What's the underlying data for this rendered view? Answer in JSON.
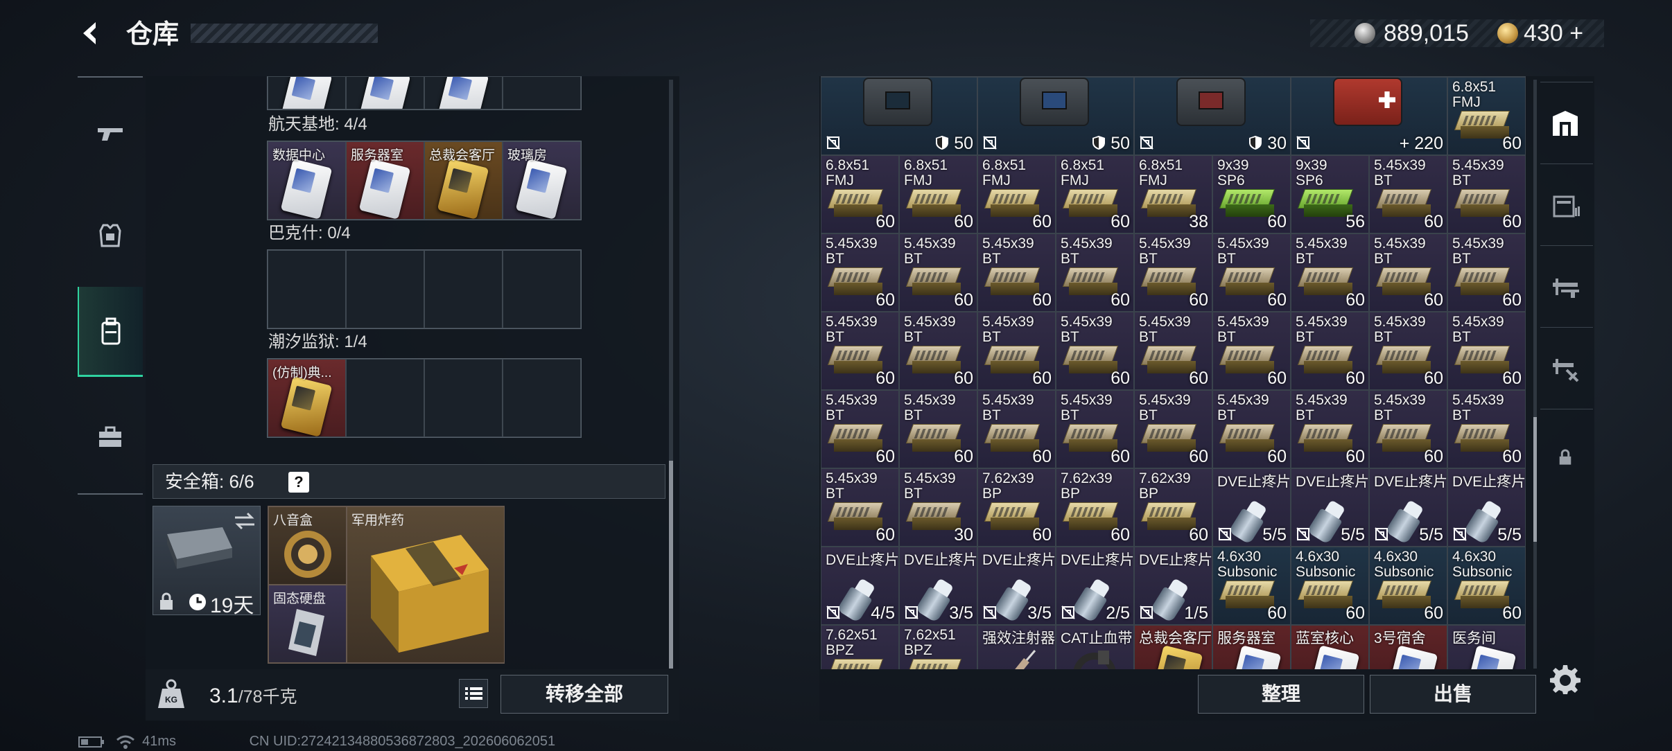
{
  "header": {
    "back_icon": "back-arrow-icon",
    "title": "仓库"
  },
  "currency": {
    "silver": "889,015",
    "gold": "430",
    "gold_add": "+"
  },
  "left_nav": [
    "weapons",
    "armor",
    "backpack",
    "toolbox"
  ],
  "keycards": {
    "top_row": [
      "",
      "",
      "",
      ""
    ],
    "sections": [
      {
        "label": "航天基地: 4/4",
        "items": [
          {
            "name": "数据中心",
            "color": "purple",
            "card": "white"
          },
          {
            "name": "服务器室",
            "color": "red",
            "card": "white"
          },
          {
            "name": "总裁会客厅",
            "color": "orange",
            "card": "gold"
          },
          {
            "name": "玻璃房",
            "color": "purple",
            "card": "white"
          }
        ]
      },
      {
        "label": "巴克什: 0/4",
        "items": [
          {
            "name": "",
            "color": "none",
            "card": ""
          },
          {
            "name": "",
            "color": "none",
            "card": ""
          },
          {
            "name": "",
            "color": "none",
            "card": ""
          },
          {
            "name": "",
            "color": "none",
            "card": ""
          }
        ]
      },
      {
        "label": "潮汐监狱: 1/4",
        "items": [
          {
            "name": "(仿制)典...",
            "color": "red",
            "card": "gold"
          },
          {
            "name": "",
            "color": "none",
            "card": ""
          },
          {
            "name": "",
            "color": "none",
            "card": ""
          },
          {
            "name": "",
            "color": "none",
            "card": ""
          }
        ]
      }
    ]
  },
  "safe_box": {
    "label": "安全箱:  6/6",
    "help": "?",
    "days": "19天",
    "items": [
      {
        "name": "八音盒"
      },
      {
        "name": "军用炸药"
      },
      {
        "name": "固态硬盘"
      }
    ]
  },
  "weight": {
    "value": "3.1",
    "max": "/78千克",
    "transfer_all": "转移全部"
  },
  "status": {
    "ping": "41ms",
    "uid": "CN UID:27242134880536872803_202606062051"
  },
  "stash": {
    "rows": [
      [
        {
          "type": "bag",
          "variant": "gray",
          "l1": "",
          "l2": "",
          "count": "50",
          "nosell": true,
          "shield": true,
          "color": "teal"
        },
        {
          "type": "bag2",
          "variant": "blue",
          "l1": "",
          "l2": "",
          "count": "50",
          "nosell": true,
          "shield": true,
          "color": "teal"
        },
        {
          "type": "bag2",
          "variant": "red",
          "l1": "",
          "l2": "",
          "count": "30",
          "nosell": true,
          "shield": true,
          "color": "teal"
        },
        {
          "type": "bag2",
          "variant": "med",
          "l1": "",
          "l2": "",
          "count": "+ 220",
          "nosell": true,
          "color": "teal"
        },
        {
          "type": "ammo",
          "variant": "",
          "l1": "6.8x51",
          "l2": "FMJ",
          "count": "60",
          "color": "teal"
        }
      ],
      [
        {
          "type": "ammo",
          "variant": "",
          "l1": "6.8x51",
          "l2": "FMJ",
          "count": "60",
          "color": "purple"
        },
        {
          "type": "ammo",
          "variant": "",
          "l1": "6.8x51",
          "l2": "FMJ",
          "count": "60",
          "color": "purple"
        },
        {
          "type": "ammo",
          "variant": "",
          "l1": "6.8x51",
          "l2": "FMJ",
          "count": "60",
          "color": "purple"
        },
        {
          "type": "ammo",
          "variant": "",
          "l1": "6.8x51",
          "l2": "FMJ",
          "count": "60",
          "color": "purple"
        },
        {
          "type": "ammo",
          "variant": "",
          "l1": "6.8x51",
          "l2": "FMJ",
          "count": "38",
          "color": "purple"
        },
        {
          "type": "ammo",
          "variant": "green",
          "l1": "9x39",
          "l2": "SP6",
          "count": "60",
          "color": "purple"
        },
        {
          "type": "ammo",
          "variant": "green",
          "l1": "9x39",
          "l2": "SP6",
          "count": "56",
          "color": "purple"
        },
        {
          "type": "ammo",
          "variant": "dark",
          "l1": "5.45x39",
          "l2": "BT",
          "count": "60",
          "color": "purple"
        },
        {
          "type": "ammo",
          "variant": "dark",
          "l1": "5.45x39",
          "l2": "BT",
          "count": "60",
          "color": "purple"
        }
      ],
      [
        {
          "type": "ammo",
          "variant": "dark",
          "l1": "5.45x39",
          "l2": "BT",
          "count": "60",
          "color": "purple"
        },
        {
          "type": "ammo",
          "variant": "dark",
          "l1": "5.45x39",
          "l2": "BT",
          "count": "60",
          "color": "purple"
        },
        {
          "type": "ammo",
          "variant": "dark",
          "l1": "5.45x39",
          "l2": "BT",
          "count": "60",
          "color": "purple"
        },
        {
          "type": "ammo",
          "variant": "dark",
          "l1": "5.45x39",
          "l2": "BT",
          "count": "60",
          "color": "purple"
        },
        {
          "type": "ammo",
          "variant": "dark",
          "l1": "5.45x39",
          "l2": "BT",
          "count": "60",
          "color": "purple"
        },
        {
          "type": "ammo",
          "variant": "dark",
          "l1": "5.45x39",
          "l2": "BT",
          "count": "60",
          "color": "purple"
        },
        {
          "type": "ammo",
          "variant": "dark",
          "l1": "5.45x39",
          "l2": "BT",
          "count": "60",
          "color": "purple"
        },
        {
          "type": "ammo",
          "variant": "dark",
          "l1": "5.45x39",
          "l2": "BT",
          "count": "60",
          "color": "purple"
        },
        {
          "type": "ammo",
          "variant": "dark",
          "l1": "5.45x39",
          "l2": "BT",
          "count": "60",
          "color": "purple"
        }
      ],
      [
        {
          "type": "ammo",
          "variant": "dark",
          "l1": "5.45x39",
          "l2": "BT",
          "count": "60",
          "color": "purple"
        },
        {
          "type": "ammo",
          "variant": "dark",
          "l1": "5.45x39",
          "l2": "BT",
          "count": "60",
          "color": "purple"
        },
        {
          "type": "ammo",
          "variant": "dark",
          "l1": "5.45x39",
          "l2": "BT",
          "count": "60",
          "color": "purple"
        },
        {
          "type": "ammo",
          "variant": "dark",
          "l1": "5.45x39",
          "l2": "BT",
          "count": "60",
          "color": "purple"
        },
        {
          "type": "ammo",
          "variant": "dark",
          "l1": "5.45x39",
          "l2": "BT",
          "count": "60",
          "color": "purple"
        },
        {
          "type": "ammo",
          "variant": "dark",
          "l1": "5.45x39",
          "l2": "BT",
          "count": "60",
          "color": "purple"
        },
        {
          "type": "ammo",
          "variant": "dark",
          "l1": "5.45x39",
          "l2": "BT",
          "count": "60",
          "color": "purple"
        },
        {
          "type": "ammo",
          "variant": "dark",
          "l1": "5.45x39",
          "l2": "BT",
          "count": "60",
          "color": "purple"
        },
        {
          "type": "ammo",
          "variant": "dark",
          "l1": "5.45x39",
          "l2": "BT",
          "count": "60",
          "color": "purple"
        }
      ],
      [
        {
          "type": "ammo",
          "variant": "dark",
          "l1": "5.45x39",
          "l2": "BT",
          "count": "60",
          "color": "purple"
        },
        {
          "type": "ammo",
          "variant": "dark",
          "l1": "5.45x39",
          "l2": "BT",
          "count": "60",
          "color": "purple"
        },
        {
          "type": "ammo",
          "variant": "dark",
          "l1": "5.45x39",
          "l2": "BT",
          "count": "60",
          "color": "purple"
        },
        {
          "type": "ammo",
          "variant": "dark",
          "l1": "5.45x39",
          "l2": "BT",
          "count": "60",
          "color": "purple"
        },
        {
          "type": "ammo",
          "variant": "dark",
          "l1": "5.45x39",
          "l2": "BT",
          "count": "60",
          "color": "purple"
        },
        {
          "type": "ammo",
          "variant": "dark",
          "l1": "5.45x39",
          "l2": "BT",
          "count": "60",
          "color": "purple"
        },
        {
          "type": "ammo",
          "variant": "dark",
          "l1": "5.45x39",
          "l2": "BT",
          "count": "60",
          "color": "purple"
        },
        {
          "type": "ammo",
          "variant": "dark",
          "l1": "5.45x39",
          "l2": "BT",
          "count": "60",
          "color": "purple"
        },
        {
          "type": "ammo",
          "variant": "dark",
          "l1": "5.45x39",
          "l2": "BT",
          "count": "60",
          "color": "purple"
        }
      ],
      [
        {
          "type": "ammo",
          "variant": "dark",
          "l1": "5.45x39",
          "l2": "BT",
          "count": "60",
          "color": "purple"
        },
        {
          "type": "ammo",
          "variant": "dark",
          "l1": "5.45x39",
          "l2": "BT",
          "count": "30",
          "color": "purple"
        },
        {
          "type": "ammo",
          "variant": "",
          "l1": "7.62x39",
          "l2": "BP",
          "count": "60",
          "color": "purple"
        },
        {
          "type": "ammo",
          "variant": "",
          "l1": "7.62x39",
          "l2": "BP",
          "count": "60",
          "color": "purple"
        },
        {
          "type": "ammo",
          "variant": "",
          "l1": "7.62x39",
          "l2": "BP",
          "count": "60",
          "color": "purple"
        },
        {
          "type": "pill",
          "variant": "",
          "l1": "DVE止疼片",
          "l2": "",
          "count": "5/5",
          "nosell": true,
          "color": "purple"
        },
        {
          "type": "pill",
          "variant": "",
          "l1": "DVE止疼片",
          "l2": "",
          "count": "5/5",
          "nosell": true,
          "color": "purple"
        },
        {
          "type": "pill",
          "variant": "",
          "l1": "DVE止疼片",
          "l2": "",
          "count": "5/5",
          "nosell": true,
          "color": "purple"
        },
        {
          "type": "pill",
          "variant": "",
          "l1": "DVE止疼片",
          "l2": "",
          "count": "5/5",
          "nosell": true,
          "color": "purple"
        }
      ],
      [
        {
          "type": "pill",
          "variant": "",
          "l1": "DVE止疼片",
          "l2": "",
          "count": "4/5",
          "nosell": true,
          "color": "purple"
        },
        {
          "type": "pill",
          "variant": "",
          "l1": "DVE止疼片",
          "l2": "",
          "count": "3/5",
          "nosell": true,
          "color": "purple"
        },
        {
          "type": "pill",
          "variant": "",
          "l1": "DVE止疼片",
          "l2": "",
          "count": "3/5",
          "nosell": true,
          "color": "purple"
        },
        {
          "type": "pill",
          "variant": "",
          "l1": "DVE止疼片",
          "l2": "",
          "count": "2/5",
          "nosell": true,
          "color": "purple"
        },
        {
          "type": "pill",
          "variant": "",
          "l1": "DVE止疼片",
          "l2": "",
          "count": "1/5",
          "nosell": true,
          "color": "purple"
        },
        {
          "type": "ammo",
          "variant": "",
          "l1": "4.6x30",
          "l2": "Subsonic",
          "count": "60",
          "color": "teal"
        },
        {
          "type": "ammo",
          "variant": "",
          "l1": "4.6x30",
          "l2": "Subsonic",
          "count": "60",
          "color": "teal"
        },
        {
          "type": "ammo",
          "variant": "",
          "l1": "4.6x30",
          "l2": "Subsonic",
          "count": "60",
          "color": "teal"
        },
        {
          "type": "ammo",
          "variant": "",
          "l1": "4.6x30",
          "l2": "Subsonic",
          "count": "60",
          "color": "teal"
        }
      ],
      [
        {
          "type": "ammo",
          "variant": "",
          "l1": "7.62x51",
          "l2": "BPZ",
          "count": "",
          "color": "purple"
        },
        {
          "type": "ammo",
          "variant": "",
          "l1": "7.62x51",
          "l2": "BPZ",
          "count": "",
          "color": "purple"
        },
        {
          "type": "syringe",
          "variant": "",
          "l1": "强效注射器",
          "l2": "",
          "count": "",
          "color": "purple"
        },
        {
          "type": "band",
          "variant": "",
          "l1": "CAT止血带",
          "l2": "",
          "count": "",
          "color": "purple"
        },
        {
          "type": "card",
          "variant": "gold",
          "l1": "总裁会客厅",
          "l2": "",
          "count": "",
          "color": "red"
        },
        {
          "type": "card",
          "variant": "",
          "l1": "服务器室",
          "l2": "",
          "count": "",
          "color": "red"
        },
        {
          "type": "card",
          "variant": "",
          "l1": "蓝室核心",
          "l2": "",
          "count": "",
          "color": "red"
        },
        {
          "type": "card",
          "variant": "",
          "l1": "3号宿舍",
          "l2": "",
          "count": "",
          "color": "red"
        },
        {
          "type": "card",
          "variant": "",
          "l1": "医务间",
          "l2": "",
          "count": "",
          "color": "purple"
        }
      ]
    ]
  },
  "buttons": {
    "tidy": "整理",
    "sell": "出售"
  },
  "right_nav": [
    "container-tab",
    "loot-box-tab",
    "weapon-rack-tab",
    "weapon-repair-tab",
    "locked-tab"
  ]
}
